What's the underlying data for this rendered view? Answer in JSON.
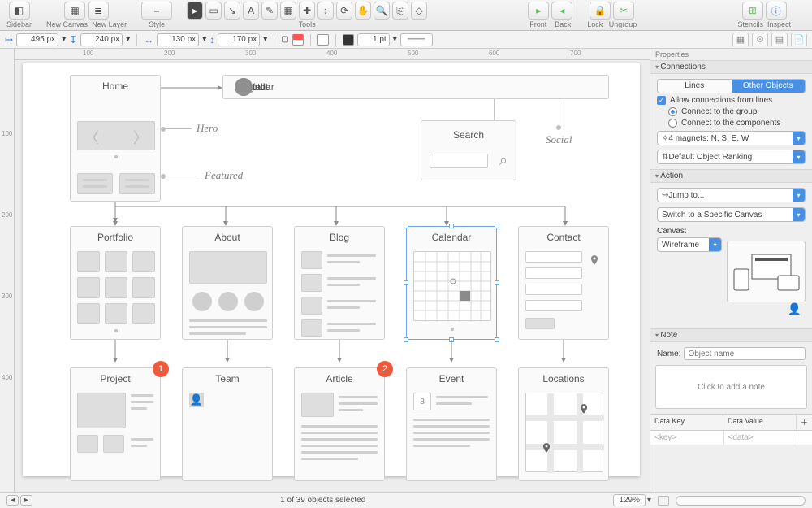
{
  "toolbar": {
    "sidebar": "Sidebar",
    "newCanvas": "New Canvas",
    "newLayer": "New Layer",
    "style": "Style",
    "tools": "Tools",
    "front": "Front",
    "back": "Back",
    "lock": "Lock",
    "ungroup": "Ungroup",
    "stencils": "Stencils",
    "inspect": "Inspect"
  },
  "geom": {
    "x": "495 px",
    "y": "240 px",
    "w": "130 px",
    "h": "170 px",
    "stroke": "1 pt"
  },
  "ruler": {
    "h": [
      "100",
      "200",
      "300",
      "400",
      "500",
      "600",
      "700"
    ],
    "v": [
      "100",
      "200",
      "300",
      "400"
    ]
  },
  "canvas": {
    "home": "Home",
    "nav": [
      "Portfolio",
      "About",
      "Blog",
      "Calendar",
      "Contact",
      "Search"
    ],
    "hero": "Hero",
    "featured": "Featured",
    "social": "Social",
    "search": {
      "title": "Search",
      "placeholder": ""
    },
    "pages": {
      "portfolio": "Portfolio",
      "about": "About",
      "blog": "Blog",
      "calendar": "Calendar",
      "contact": "Contact",
      "project": "Project",
      "team": "Team",
      "article": "Article",
      "event": "Event",
      "locations": "Locations"
    },
    "badge1": "1",
    "badge2": "2",
    "eventDay": "8"
  },
  "status": {
    "selection": "1 of 39 objects selected",
    "zoom": "129%"
  },
  "inspector": {
    "propsTitle": "Properties",
    "connections": {
      "title": "Connections",
      "seg": [
        "Lines",
        "Other Objects"
      ],
      "allow": "Allow connections from lines",
      "group": "Connect to the group",
      "components": "Connect to the components",
      "magnets": "4 magnets: N, S, E, W",
      "ranking": "Default Object Ranking"
    },
    "action": {
      "title": "Action",
      "jump": "Jump to...",
      "switch": "Switch to a Specific Canvas",
      "canvasLabel": "Canvas:",
      "canvas": "Wireframe"
    },
    "note": {
      "title": "Note",
      "nameLabel": "Name:",
      "namePlaceholder": "Object name",
      "add": "Click to add a note",
      "keyHeader": "Data Key",
      "valHeader": "Data Value",
      "keyPh": "<key>",
      "valPh": "<data>"
    }
  }
}
